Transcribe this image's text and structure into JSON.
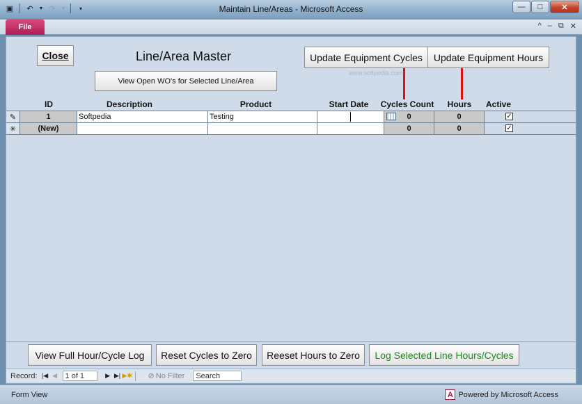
{
  "window": {
    "title": "Maintain Line/Areas  -  Microsoft Access",
    "controls": {
      "minimize_icon": "minimize-icon",
      "maximize_icon": "maximize-icon",
      "close_icon": "close-icon"
    }
  },
  "quick_access": {
    "icons": [
      "access-app-icon",
      "undo-icon",
      "redo-icon",
      "customize-icon"
    ]
  },
  "ribbon": {
    "file_tab": "File",
    "right_icons": [
      "help-icon",
      "minimize-ribbon-icon",
      "restore-icon",
      "close-doc-icon"
    ]
  },
  "form": {
    "title": "Line/Area Master",
    "close_label": "Close",
    "view_open_label": "View Open WO's for Selected Line/Area",
    "update_cycles_label": "Update Equipment Cycles",
    "update_hours_label": "Update Equipment Hours",
    "watermark": "www.softpedia.com"
  },
  "grid": {
    "columns": [
      "ID",
      "Description",
      "Product",
      "Start Date",
      "Cycles Count",
      "Hours",
      "Active"
    ],
    "rows": [
      {
        "id": "1",
        "description": "Softpedia",
        "product": "Testing",
        "start_date": "",
        "cycles": "0",
        "hours": "0",
        "active": true,
        "selector": "pencil-icon"
      },
      {
        "id": "(New)",
        "description": "",
        "product": "",
        "start_date": "",
        "cycles": "0",
        "hours": "0",
        "active": true,
        "selector": "new-record-icon"
      }
    ]
  },
  "footer": {
    "view_log_label": "View Full Hour/Cycle Log",
    "reset_cycles_label": "Reset Cycles to Zero",
    "reset_hours_label": "Reeset Hours to Zero",
    "log_selected_label": "Log Selected Line Hours/Cycles",
    "log_selected_color": "#1a8a1a"
  },
  "record_nav": {
    "label": "Record:",
    "counter": "1 of 1",
    "filter_label": "No Filter",
    "search_placeholder": "Search"
  },
  "status": {
    "left": "Form View",
    "right": "Powered by Microsoft Access"
  },
  "colors": {
    "annotation_red": "#e01010",
    "form_bg": "#cfdbe8"
  }
}
